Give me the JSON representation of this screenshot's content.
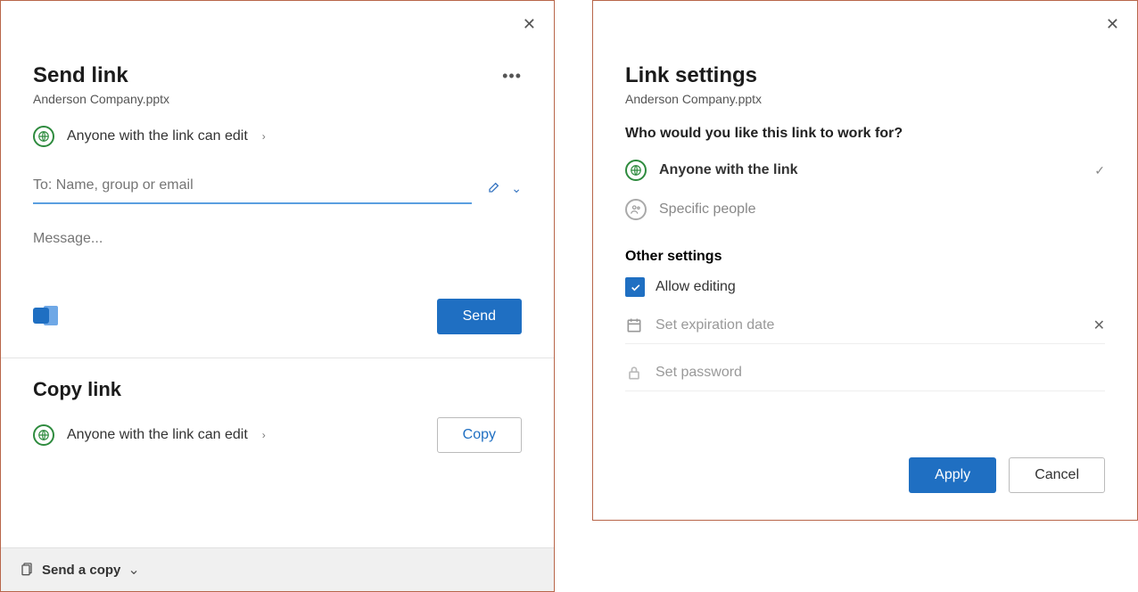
{
  "send": {
    "title": "Send link",
    "filename": "Anderson Company.pptx",
    "scope_text": "Anyone with the link can edit",
    "to_placeholder": "To: Name, group or email",
    "message_placeholder": "Message...",
    "send_button": "Send"
  },
  "copy": {
    "title": "Copy link",
    "scope_text": "Anyone with the link can edit",
    "copy_button": "Copy"
  },
  "send_copy": {
    "label": "Send a copy"
  },
  "settings": {
    "title": "Link settings",
    "filename": "Anderson Company.pptx",
    "subheading": "Who would you like this link to work for?",
    "option_anyone": "Anyone with the link",
    "option_specific": "Specific people",
    "other_heading": "Other settings",
    "allow_editing": "Allow editing",
    "expiration_placeholder": "Set expiration date",
    "password_placeholder": "Set password",
    "apply": "Apply",
    "cancel": "Cancel"
  }
}
